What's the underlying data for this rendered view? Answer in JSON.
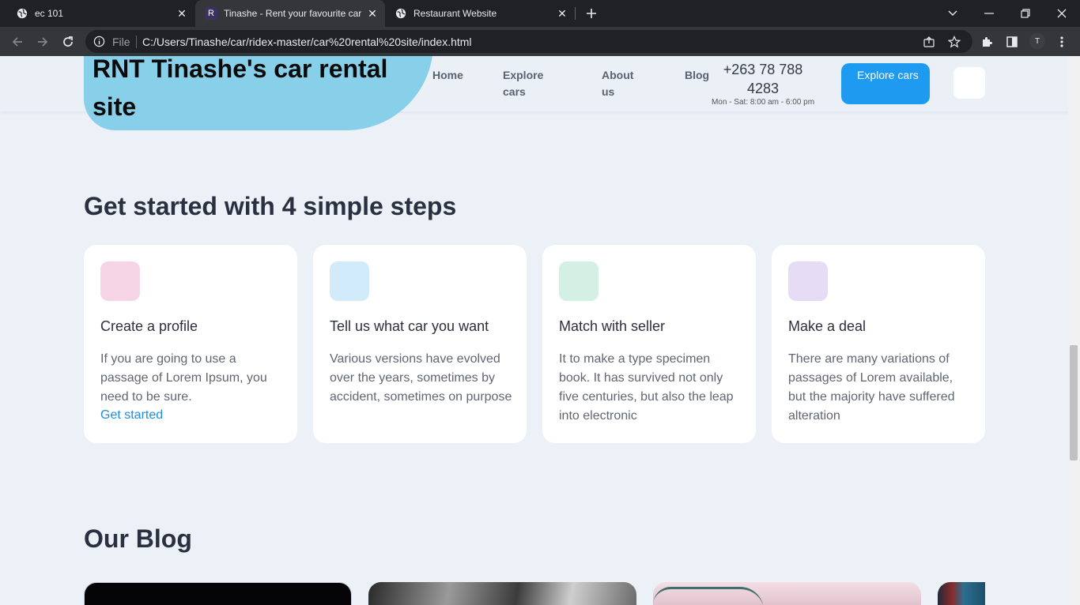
{
  "browser": {
    "tabs": [
      {
        "title": "ec 101",
        "icon": "globe-icon"
      },
      {
        "title": "Tinashe - Rent your favourite car",
        "icon": "r-favicon",
        "favicon_letter": "R"
      },
      {
        "title": "Restaurant Website",
        "icon": "globe-icon"
      }
    ],
    "omnibox": {
      "scheme_label": "File",
      "url": "C:/Users/Tinashe/car/ridex-master/car%20rental%20site/index.html"
    },
    "profile_initial": "T"
  },
  "header": {
    "logo_text": "RNT Tinashe's car rental site",
    "nav": [
      {
        "label": "Home"
      },
      {
        "label": "Explore cars"
      },
      {
        "label": "About us"
      },
      {
        "label": "Blog"
      }
    ],
    "phone": "+263 78 788 4283",
    "hours": "Mon - Sat: 8:00 am - 6:00 pm",
    "cta_label": "Explore cars"
  },
  "steps": {
    "title": "Get started with 4 simple steps",
    "cards": [
      {
        "title": "Create a profile",
        "text": "If you are going to use a passage of Lorem Ipsum, you need to be sure.",
        "link": "Get started",
        "color": "#f5d5e6"
      },
      {
        "title": "Tell us what car you want",
        "text": "Various versions have evolved over the years, sometimes by accident, sometimes on purpose",
        "color": "#d2ebfb"
      },
      {
        "title": "Match with seller",
        "text": "It to make a type specimen book. It has survived not only five centuries, but also the leap into electronic",
        "color": "#d4efe3"
      },
      {
        "title": "Make a deal",
        "text": "There are many variations of passages of Lorem available, but the majority have suffered alteration",
        "color": "#e6dcf5"
      }
    ]
  },
  "blog": {
    "title": "Our Blog"
  }
}
